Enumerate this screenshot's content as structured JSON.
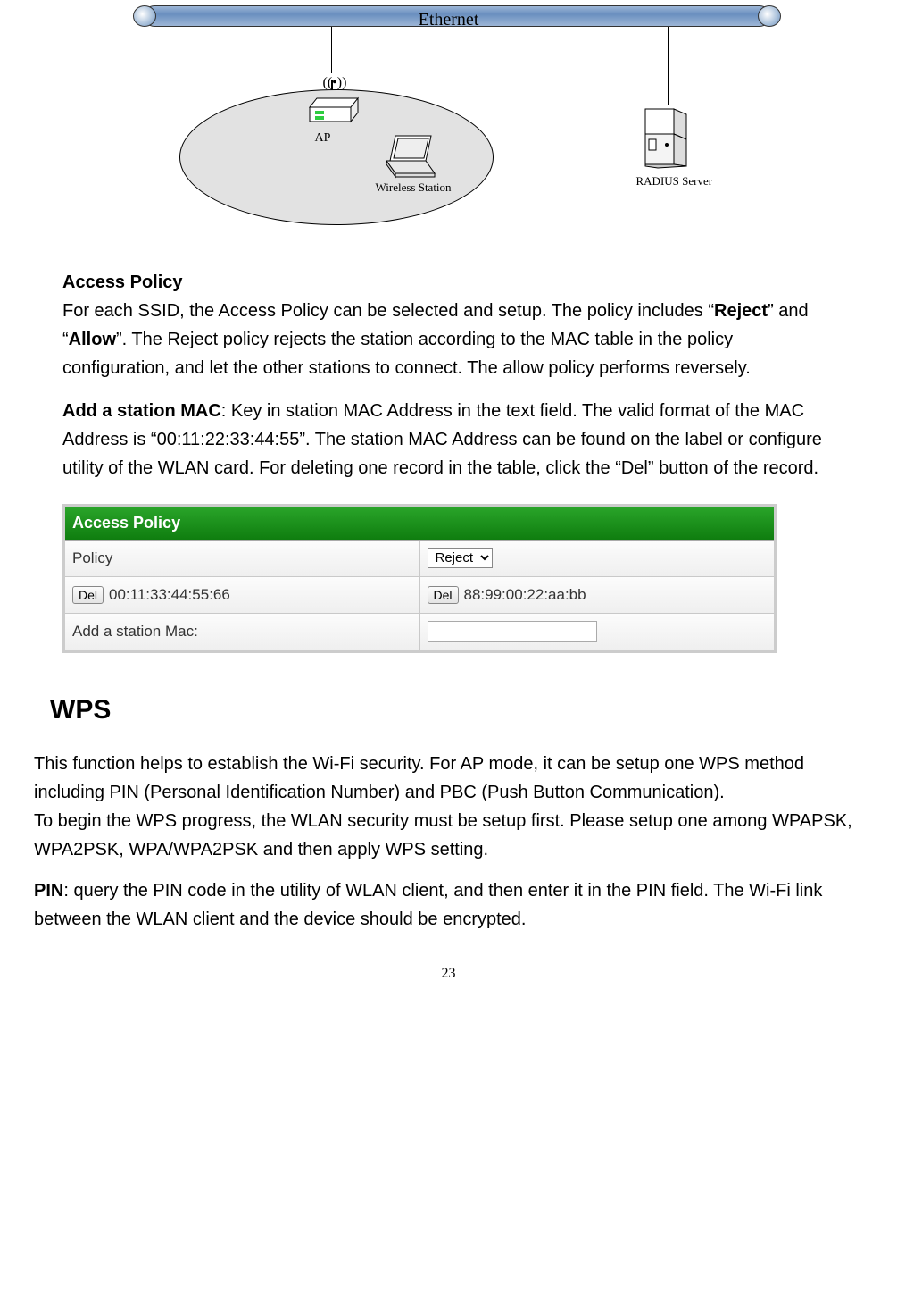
{
  "diagram": {
    "ethernet_label": "Ethernet",
    "ap_label": "AP",
    "wireless_station_label": "Wireless Station",
    "radius_server_label": "RADIUS Server"
  },
  "access_policy_text": {
    "heading": "Access Policy",
    "para": "For each SSID, the Access Policy can be selected and setup. The policy includes “",
    "reject": "Reject",
    "mid1": "” and “",
    "allow": "Allow",
    "mid2": "”. The Reject policy rejects the station according to the MAC table in the policy configuration, and let the other stations to connect. The allow policy performs reversely."
  },
  "add_station_text": {
    "lead": "Add a station MAC",
    "body": ": Key in station MAC Address in the text field. The valid format of the MAC Address is “00:11:22:33:44:55”. The station MAC Address can be found on the label or configure utility of the WLAN card. For deleting one record in the table, click the “Del” button of the record."
  },
  "panel": {
    "title": "Access Policy",
    "policy_label": "Policy",
    "policy_value": "Reject",
    "del_label": "Del",
    "mac1": "00:11:33:44:55:66",
    "mac2": "88:99:00:22:aa:bb",
    "add_label": "Add a station Mac:",
    "add_value": ""
  },
  "wps": {
    "heading": "WPS",
    "p1": "This function helps to establish the Wi-Fi security. For AP mode, it can be setup one WPS method including PIN (Personal Identification Number) and PBC (Push Button Communication).",
    "p2": "To begin the WPS progress, the WLAN security must be setup first. Please setup one among WPAPSK, WPA2PSK, WPA/WPA2PSK and then apply WPS setting.",
    "pin_lead": "PIN",
    "pin_body": ": query the PIN code in the utility of WLAN client, and then enter it in the PIN field. The Wi-Fi link between the WLAN client and the device should be encrypted."
  },
  "page_number": "23"
}
